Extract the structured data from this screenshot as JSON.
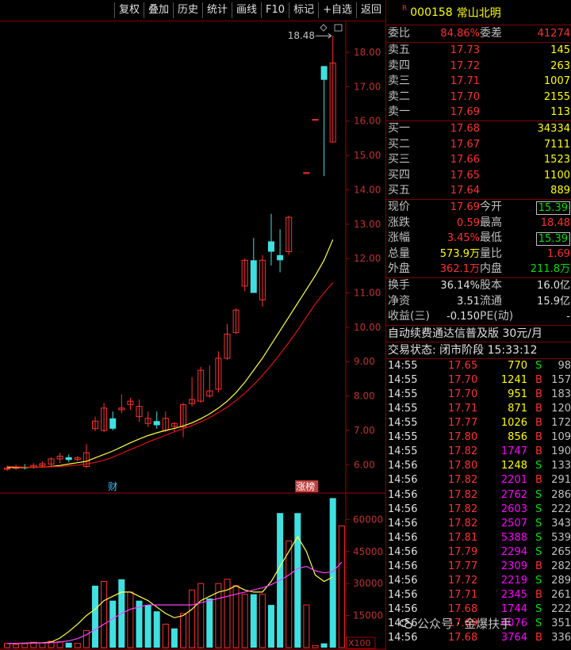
{
  "toolbar": {
    "items": [
      "复权",
      "叠加",
      "历史",
      "统计",
      "画线",
      "F10",
      "标记",
      "+自选",
      "返回"
    ]
  },
  "stock": {
    "code": "000158",
    "name": "常山北明"
  },
  "weibi": {
    "label": "委比",
    "value": "84.86%",
    "label2": "委差",
    "value2": "41274"
  },
  "asks": [
    {
      "label": "卖五",
      "price": "17.73",
      "vol": "145"
    },
    {
      "label": "卖四",
      "price": "17.72",
      "vol": "263"
    },
    {
      "label": "卖三",
      "price": "17.71",
      "vol": "1007"
    },
    {
      "label": "卖二",
      "price": "17.70",
      "vol": "2155"
    },
    {
      "label": "卖一",
      "price": "17.69",
      "vol": "113"
    }
  ],
  "bids": [
    {
      "label": "买一",
      "price": "17.68",
      "vol": "34334"
    },
    {
      "label": "买二",
      "price": "17.67",
      "vol": "7111"
    },
    {
      "label": "买三",
      "price": "17.66",
      "vol": "1523"
    },
    {
      "label": "买四",
      "price": "17.65",
      "vol": "1100"
    },
    {
      "label": "买五",
      "price": "17.64",
      "vol": "889"
    }
  ],
  "quote": {
    "xianjia": {
      "label": "现价",
      "value": "17.69"
    },
    "jinkai": {
      "label": "今开",
      "value": "15.39"
    },
    "zhangdie": {
      "label": "涨跌",
      "value": "0.59"
    },
    "zuigao": {
      "label": "最高",
      "value": "18.48"
    },
    "zhangfu": {
      "label": "涨幅",
      "value": "3.45%"
    },
    "zuidi": {
      "label": "最低",
      "value": "15.39"
    },
    "zongliang": {
      "label": "总量",
      "value": "573.9万"
    },
    "liangbi": {
      "label": "量比",
      "value": "1.69"
    },
    "waipan": {
      "label": "外盘",
      "value": "362.1万"
    },
    "neipan": {
      "label": "内盘",
      "value": "211.8万"
    }
  },
  "fund": {
    "huanshou": {
      "label": "换手",
      "value": "36.14%"
    },
    "guben": {
      "label": "股本",
      "value": "16.0亿"
    },
    "jingzi": {
      "label": "净资",
      "value": "3.51"
    },
    "liutong": {
      "label": "流通",
      "value": "15.9亿"
    },
    "shouyi": {
      "label": "收益(三)",
      "value": "-0.150"
    },
    "pe": {
      "label": "PE(动)",
      "value": "-"
    }
  },
  "ad_text": "自动续费通达信普及版  30元/月",
  "status": {
    "label": "交易状态:",
    "value": "闭市阶段 15:33:12"
  },
  "trades": [
    {
      "time": "14:55",
      "price": "17.65",
      "vol": "770",
      "bs": "S",
      "n": "98",
      "pc": "red",
      "vc": "yellow"
    },
    {
      "time": "14:55",
      "price": "17.70",
      "vol": "1241",
      "bs": "B",
      "n": "157",
      "pc": "red",
      "vc": "yellow"
    },
    {
      "time": "14:55",
      "price": "17.70",
      "vol": "951",
      "bs": "B",
      "n": "183",
      "pc": "red",
      "vc": "yellow"
    },
    {
      "time": "14:55",
      "price": "17.71",
      "vol": "871",
      "bs": "B",
      "n": "120",
      "pc": "red",
      "vc": "yellow"
    },
    {
      "time": "14:55",
      "price": "17.77",
      "vol": "1026",
      "bs": "B",
      "n": "172",
      "pc": "red",
      "vc": "yellow"
    },
    {
      "time": "14:55",
      "price": "17.80",
      "vol": "856",
      "bs": "B",
      "n": "109",
      "pc": "red",
      "vc": "yellow"
    },
    {
      "time": "14:55",
      "price": "17.82",
      "vol": "1747",
      "bs": "B",
      "n": "190",
      "pc": "red",
      "vc": "magenta"
    },
    {
      "time": "14:56",
      "price": "17.80",
      "vol": "1248",
      "bs": "S",
      "n": "133",
      "pc": "red",
      "vc": "yellow"
    },
    {
      "time": "14:56",
      "price": "17.82",
      "vol": "2201",
      "bs": "B",
      "n": "291",
      "pc": "red",
      "vc": "magenta"
    },
    {
      "time": "14:56",
      "price": "17.82",
      "vol": "2762",
      "bs": "S",
      "n": "286",
      "pc": "red",
      "vc": "magenta"
    },
    {
      "time": "14:56",
      "price": "17.82",
      "vol": "2603",
      "bs": "S",
      "n": "222",
      "pc": "red",
      "vc": "magenta"
    },
    {
      "time": "14:56",
      "price": "17.82",
      "vol": "2507",
      "bs": "S",
      "n": "343",
      "pc": "red",
      "vc": "magenta"
    },
    {
      "time": "14:56",
      "price": "17.81",
      "vol": "5388",
      "bs": "S",
      "n": "539",
      "pc": "red",
      "vc": "magenta"
    },
    {
      "time": "14:56",
      "price": "17.79",
      "vol": "2294",
      "bs": "S",
      "n": "265",
      "pc": "red",
      "vc": "magenta"
    },
    {
      "time": "14:56",
      "price": "17.77",
      "vol": "2309",
      "bs": "B",
      "n": "282",
      "pc": "red",
      "vc": "magenta"
    },
    {
      "time": "14:56",
      "price": "17.72",
      "vol": "2219",
      "bs": "S",
      "n": "289",
      "pc": "red",
      "vc": "magenta"
    },
    {
      "time": "14:56",
      "price": "17.71",
      "vol": "2345",
      "bs": "B",
      "n": "261",
      "pc": "red",
      "vc": "magenta"
    },
    {
      "time": "14:56",
      "price": "17.68",
      "vol": "1744",
      "bs": "S",
      "n": "222",
      "pc": "red",
      "vc": "magenta"
    },
    {
      "time": "14:56",
      "price": "17.69",
      "vol": "4076",
      "bs": "S",
      "n": "351",
      "pc": "red",
      "vc": "magenta"
    },
    {
      "time": "14:56",
      "price": "17.68",
      "vol": "3764",
      "bs": "B",
      "n": "336",
      "pc": "red",
      "vc": "magenta"
    }
  ],
  "watermark": "公众号 · 金爆扶手",
  "chart_data": {
    "type": "candlestick",
    "price_axis": {
      "ticks": [
        6.0,
        7.0,
        8.0,
        9.0,
        10.0,
        11.0,
        12.0,
        13.0,
        14.0,
        15.0,
        16.0,
        17.0,
        18.0
      ],
      "range": [
        5.2,
        18.9
      ]
    },
    "max_label": "18.48",
    "markers": [
      "财",
      "涨榜"
    ],
    "candles": [
      {
        "o": 5.87,
        "h": 5.98,
        "l": 5.82,
        "c": 5.9
      },
      {
        "o": 5.9,
        "h": 6.0,
        "l": 5.85,
        "c": 5.93
      },
      {
        "o": 5.93,
        "h": 6.02,
        "l": 5.86,
        "c": 5.92
      },
      {
        "o": 5.92,
        "h": 6.05,
        "l": 5.88,
        "c": 5.98
      },
      {
        "o": 5.98,
        "h": 6.1,
        "l": 5.92,
        "c": 6.03
      },
      {
        "o": 6.02,
        "h": 6.22,
        "l": 5.95,
        "c": 6.17
      },
      {
        "o": 6.17,
        "h": 6.35,
        "l": 6.05,
        "c": 6.25
      },
      {
        "o": 6.22,
        "h": 6.3,
        "l": 6.08,
        "c": 6.14
      },
      {
        "o": 6.15,
        "h": 6.26,
        "l": 6.1,
        "c": 6.2
      },
      {
        "o": 5.95,
        "h": 6.6,
        "l": 5.9,
        "c": 6.35
      },
      {
        "o": 7.05,
        "h": 7.4,
        "l": 6.98,
        "c": 7.27
      },
      {
        "o": 7.0,
        "h": 7.8,
        "l": 6.95,
        "c": 7.65
      },
      {
        "o": 7.35,
        "h": 7.55,
        "l": 7.0,
        "c": 7.05
      },
      {
        "o": 7.6,
        "h": 8.05,
        "l": 7.5,
        "c": 7.65
      },
      {
        "o": 7.75,
        "h": 7.95,
        "l": 7.6,
        "c": 7.85
      },
      {
        "o": 7.4,
        "h": 7.9,
        "l": 7.25,
        "c": 7.7
      },
      {
        "o": 7.2,
        "h": 7.55,
        "l": 7.1,
        "c": 7.35
      },
      {
        "o": 7.27,
        "h": 7.55,
        "l": 7.05,
        "c": 7.15
      },
      {
        "o": 7.0,
        "h": 7.55,
        "l": 6.95,
        "c": 7.35
      },
      {
        "o": 7.12,
        "h": 7.25,
        "l": 6.95,
        "c": 7.2
      },
      {
        "o": 7.1,
        "h": 7.8,
        "l": 6.8,
        "c": 7.75
      },
      {
        "o": 7.78,
        "h": 8.55,
        "l": 7.7,
        "c": 7.9
      },
      {
        "o": 7.85,
        "h": 8.85,
        "l": 7.8,
        "c": 8.75
      },
      {
        "o": 8.0,
        "h": 8.9,
        "l": 7.95,
        "c": 8.15
      },
      {
        "o": 8.2,
        "h": 9.3,
        "l": 8.1,
        "c": 9.1
      },
      {
        "o": 9.1,
        "h": 10.1,
        "l": 9.05,
        "c": 9.8
      },
      {
        "o": 9.85,
        "h": 10.55,
        "l": 9.8,
        "c": 10.5
      },
      {
        "o": 11.2,
        "h": 12.0,
        "l": 11.05,
        "c": 11.95
      },
      {
        "o": 11.95,
        "h": 12.6,
        "l": 11.0,
        "c": 11.0
      },
      {
        "o": 10.8,
        "h": 12.1,
        "l": 10.6,
        "c": 11.95
      },
      {
        "o": 12.5,
        "h": 13.3,
        "l": 11.8,
        "c": 12.2
      },
      {
        "o": 12.1,
        "h": 12.85,
        "l": 11.6,
        "c": 11.95
      },
      {
        "o": 12.2,
        "h": 13.25,
        "l": 12.1,
        "c": 13.2
      },
      {
        "o": null,
        "h": null,
        "l": null,
        "c": null
      },
      {
        "o": 14.5,
        "h": 14.5,
        "l": 14.5,
        "c": 14.5
      },
      {
        "o": 16.05,
        "h": 16.05,
        "l": 16.05,
        "c": 16.05
      },
      {
        "o": 17.6,
        "h": 17.6,
        "l": 14.4,
        "c": 17.2
      },
      {
        "o": 15.39,
        "h": 18.48,
        "l": 15.39,
        "c": 17.69
      }
    ],
    "ma_yellow": [
      5.92,
      5.92,
      5.92,
      5.93,
      5.93,
      5.95,
      5.98,
      6.02,
      6.06,
      6.1,
      6.2,
      6.3,
      6.4,
      6.52,
      6.64,
      6.75,
      6.85,
      6.93,
      7.0,
      7.06,
      7.13,
      7.22,
      7.34,
      7.48,
      7.65,
      7.85,
      8.1,
      8.4,
      8.75,
      9.1,
      9.5,
      9.9,
      10.3,
      10.7,
      11.1,
      11.5,
      11.95,
      12.55
    ],
    "ma_red": [
      5.95,
      5.94,
      5.93,
      5.93,
      5.93,
      5.94,
      5.95,
      5.97,
      5.99,
      6.02,
      6.07,
      6.13,
      6.22,
      6.33,
      6.44,
      6.55,
      6.66,
      6.76,
      6.86,
      6.96,
      7.05,
      7.14,
      7.25,
      7.37,
      7.52,
      7.68,
      7.87,
      8.08,
      8.33,
      8.6,
      8.9,
      9.22,
      9.56,
      9.92,
      10.3,
      10.68,
      11.0,
      11.3
    ],
    "volume_axis": {
      "ticks": [
        15000,
        30000,
        45000,
        60000
      ],
      "range": [
        0,
        72000
      ],
      "unit": "X100"
    },
    "volume": [
      2000,
      1500,
      1800,
      2500,
      2200,
      3000,
      2800,
      2300,
      2000,
      8000,
      29000,
      31000,
      22000,
      32000,
      26000,
      22000,
      20000,
      17000,
      11000,
      9000,
      16000,
      27000,
      30000,
      23000,
      30000,
      32000,
      29000,
      25000,
      25000,
      25000,
      20000,
      63000,
      50000,
      63000,
      20000,
      1000,
      2000,
      70000,
      57000
    ],
    "vol_up": [
      true,
      true,
      true,
      true,
      true,
      true,
      true,
      false,
      true,
      true,
      false,
      true,
      false,
      false,
      true,
      false,
      false,
      false,
      true,
      false,
      true,
      true,
      true,
      false,
      true,
      true,
      true,
      true,
      false,
      true,
      false,
      false,
      true,
      false,
      true,
      true,
      false,
      false,
      true
    ],
    "vol_ma_yellow": [
      2000,
      2000,
      2100,
      2200,
      2300,
      2600,
      4500,
      7500,
      11000,
      15000,
      18000,
      22000,
      24000,
      26000,
      26000,
      24000,
      22000,
      19000,
      16000,
      14000,
      15000,
      18000,
      22000,
      24000,
      26000,
      27000,
      29000,
      27000,
      26000,
      26000,
      31000,
      38000,
      45000,
      52000,
      45000,
      34000,
      31000,
      33000
    ],
    "vol_ma_magenta": [
      2000,
      2000,
      2000,
      2100,
      2200,
      2300,
      2600,
      3200,
      4200,
      6000,
      8500,
      11000,
      13500,
      16000,
      18000,
      19000,
      20000,
      20000,
      20000,
      20000,
      20000,
      20000,
      21000,
      22000,
      23000,
      24000,
      25000,
      26000,
      27000,
      28000,
      29500,
      31500,
      34000,
      37000,
      38000,
      36000,
      35000,
      35500,
      40000
    ]
  }
}
